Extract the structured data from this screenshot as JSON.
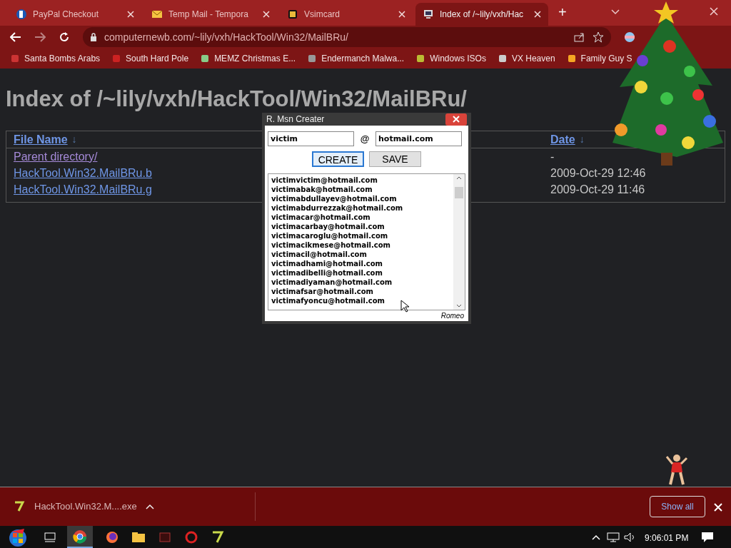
{
  "browser": {
    "tabs": [
      {
        "title": "PayPal Checkout",
        "selected": false
      },
      {
        "title": "Temp Mail - Tempora",
        "selected": false
      },
      {
        "title": "Vsimcard",
        "selected": false
      },
      {
        "title": "Index of /~lily/vxh/Hac",
        "selected": true
      }
    ],
    "new_tab": "+",
    "address": "computernewb.com/~lily/vxh/HackTool/Win32/MailBRu/",
    "bookmarks": [
      "Santa Bombs Arabs",
      "South Hard Pole",
      "MEMZ Christmas E...",
      "Endermanch Malwa...",
      "Windows ISOs",
      "VX Heaven",
      "Family Guy S"
    ]
  },
  "page": {
    "heading": "Index of /~lily/vxh/HackTool/Win32/MailBRu/",
    "columns": [
      {
        "label": "File Name",
        "sort": "↓"
      },
      {
        "label": "Date",
        "sort": "↓"
      }
    ],
    "rows": [
      {
        "name": "Parent directory/",
        "date": "-",
        "visited": true
      },
      {
        "name": "HackTool.Win32.MailBRu.b",
        "date": "2009-Oct-29 12:46",
        "visited": false
      },
      {
        "name": "HackTool.Win32.MailBRu.g",
        "date": "2009-Oct-29 11:46",
        "visited": false
      }
    ]
  },
  "dialog": {
    "title": "R. Msn Creater",
    "user": "victim",
    "at": "@",
    "domain": "hotmail.com",
    "buttons": [
      {
        "label": "CREATE",
        "focused": true
      },
      {
        "label": "SAVE",
        "focused": false
      }
    ],
    "emails": [
      "victimvictim@hotmail.com",
      "victimabak@hotmail.com",
      "victimabdullayev@hotmail.com",
      "victimabdurrezzak@hotmail.com",
      "victimacar@hotmail.com",
      "victimacarbay@hotmail.com",
      "victimacaroglu@hotmail.com",
      "victimacikmese@hotmail.com",
      "victimacil@hotmail.com",
      "victimadhami@hotmail.com",
      "victimadibelli@hotmail.com",
      "victimadiyaman@hotmail.com",
      "victimafsar@hotmail.com",
      "victimafyoncu@hotmail.com"
    ],
    "credit": "Romeo"
  },
  "downloads": {
    "file": "HackTool.Win32.M....exe",
    "button": "Show all"
  },
  "taskbar": {
    "clock": "9:06:01 PM"
  }
}
